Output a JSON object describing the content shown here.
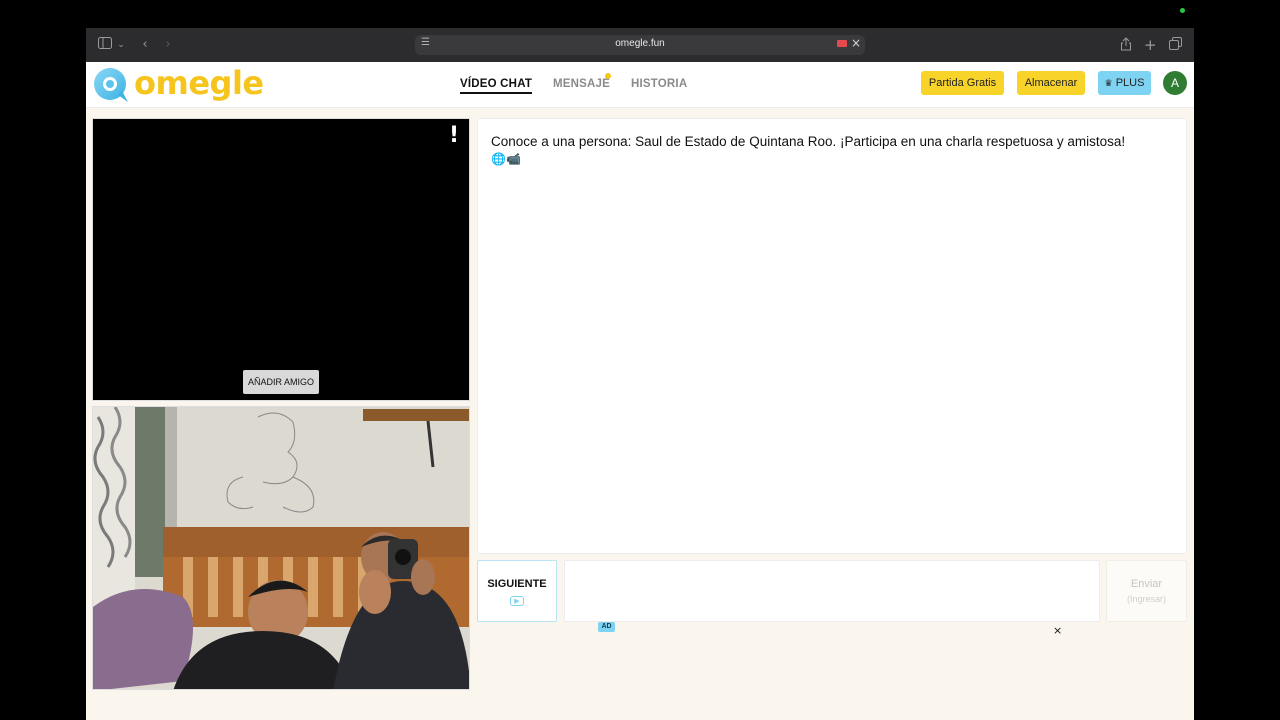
{
  "browser": {
    "url": "omegle.fun",
    "icons": [
      "sidebar-icon",
      "chevron-down-icon",
      "back-icon",
      "forward-icon",
      "site-settings-icon",
      "camera-recording-icon",
      "close-icon",
      "share-icon",
      "new-tab-icon",
      "tabs-overview-icon"
    ]
  },
  "header": {
    "logo_text": "omegle",
    "nav": {
      "video_chat": "VÍDEO CHAT",
      "mensaje": "MENSAJE",
      "historia": "HISTORIA"
    },
    "buttons": {
      "partida_gratis": "Partida Gratis",
      "almacenar": "Almacenar",
      "plus": "PLUS",
      "plus_icon": "crown-icon"
    },
    "avatar_letter": "A",
    "colors": {
      "brand_yellow": "#f5c51e",
      "button_yellow": "#f8d32a",
      "plus_blue": "#7fd3f2",
      "avatar_green": "#2e7d32"
    }
  },
  "remote_video": {
    "report_label": "!",
    "add_friend_label": "AÑADIR AMIGO"
  },
  "chat": {
    "message": "Conoce a una persona: Saul de Estado de Quintana Roo. ¡Participa en una charla respetuosa y amistosa!",
    "emojis": "🌐📹"
  },
  "controls": {
    "next_label": "SIGUIENTE",
    "next_icon": "play-icon",
    "input_value": "",
    "send_label": "Enviar",
    "send_hint": "(Ingresar)"
  },
  "ad": {
    "badge": "AD",
    "close": "×"
  }
}
